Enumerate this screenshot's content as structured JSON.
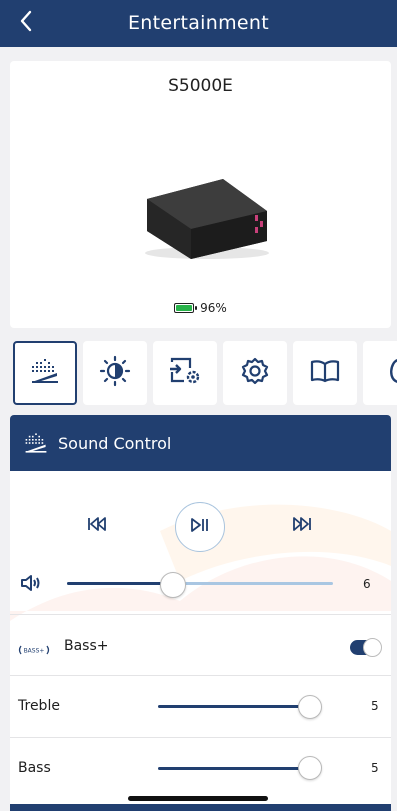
{
  "header": {
    "title": "Entertainment",
    "back_icon": "chevron-left-icon"
  },
  "device": {
    "model": "S5000E",
    "battery_text": "96%",
    "battery_level": 0.96,
    "battery_color": "#28b34a"
  },
  "tabs": [
    {
      "icon": "equalizer-icon",
      "active": true
    },
    {
      "icon": "light-icon",
      "active": false
    },
    {
      "icon": "input-settings-icon",
      "active": false
    },
    {
      "icon": "gear-icon",
      "active": false
    },
    {
      "icon": "book-icon",
      "active": false
    },
    {
      "icon": "partial-icon",
      "active": false
    }
  ],
  "section": {
    "title": "Sound Control",
    "icon": "equalizer-icon"
  },
  "playback": {
    "prev_icon": "skip-back-icon",
    "play_icon": "play-pause-icon",
    "next_icon": "skip-forward-icon"
  },
  "volume": {
    "icon": "speaker-icon",
    "value": "6",
    "level": 0.4
  },
  "bass_plus": {
    "label": "Bass+",
    "badge": "BASS+",
    "enabled": true
  },
  "treble": {
    "label": "Treble",
    "value": "5",
    "level": 1.0
  },
  "bass": {
    "label": "Bass",
    "value": "5",
    "level": 1.0
  },
  "colors": {
    "primary": "#213f70",
    "track_light": "#a9c6e2"
  }
}
